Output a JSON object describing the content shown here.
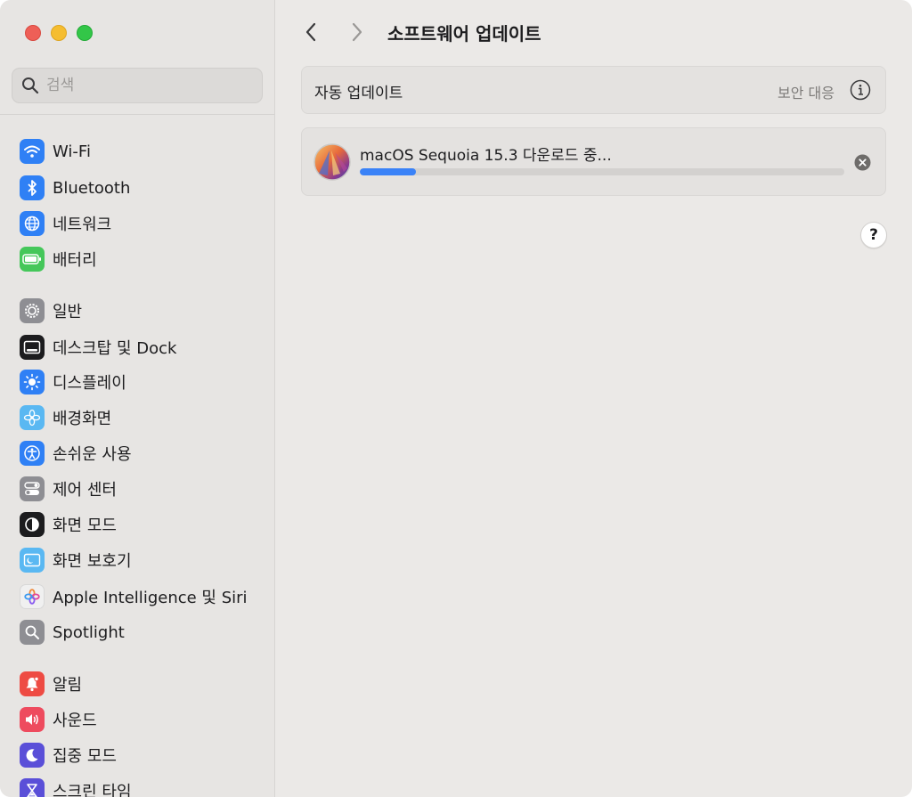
{
  "window": {
    "traffic_lights": [
      "close",
      "minimize",
      "zoom"
    ],
    "colors": {
      "close": "#ee5f57",
      "minimize": "#f5bd30",
      "zoom": "#33c648"
    }
  },
  "sidebar": {
    "search_placeholder": "검색",
    "items": [
      {
        "label": "Wi-Fi",
        "icon": "wifi-icon",
        "color": "#2f80f5"
      },
      {
        "label": "Bluetooth",
        "icon": "bluetooth-icon",
        "color": "#2f80f5"
      },
      {
        "label": "네트워크",
        "icon": "globe-icon",
        "color": "#2f80f5"
      },
      {
        "label": "배터리",
        "icon": "battery-icon",
        "color": "#45c75a"
      },
      {
        "label": "일반",
        "icon": "gear-icon",
        "color": "#8e8e93"
      },
      {
        "label": "데스크탑 및 Dock",
        "icon": "dock-icon",
        "color": "#1c1c1e"
      },
      {
        "label": "디스플레이",
        "icon": "brightness-icon",
        "color": "#2f80f5"
      },
      {
        "label": "배경화면",
        "icon": "flower-icon",
        "color": "#5ab8f2"
      },
      {
        "label": "손쉬운 사용",
        "icon": "accessibility-icon",
        "color": "#2f80f5"
      },
      {
        "label": "제어 센터",
        "icon": "toggles-icon",
        "color": "#8e8e93"
      },
      {
        "label": "화면 모드",
        "icon": "appearance-icon",
        "color": "#1c1c1e"
      },
      {
        "label": "화면 보호기",
        "icon": "screensaver-icon",
        "color": "#5ab8f2"
      },
      {
        "label": "Apple Intelligence 및 Siri",
        "icon": "apple-intelligence-icon",
        "color": "#f0f0f0"
      },
      {
        "label": "Spotlight",
        "icon": "magnifier-icon",
        "color": "#8e8e93"
      },
      {
        "label": "알림",
        "icon": "bell-icon",
        "color": "#ee4b43"
      },
      {
        "label": "사운드",
        "icon": "speaker-icon",
        "color": "#ee4b5e"
      },
      {
        "label": "집중 모드",
        "icon": "moon-icon",
        "color": "#5a4fd8"
      },
      {
        "label": "스크린 타임",
        "icon": "hourglass-icon",
        "color": "#5a4fd8"
      }
    ]
  },
  "main": {
    "title": "소프트웨어 업데이트",
    "auto_update": {
      "label": "자동 업데이트",
      "value": "보안 대응"
    },
    "download": {
      "title": "macOS Sequoia 15.3 다운로드 중...",
      "progress": 0.115
    },
    "help_label": "?"
  },
  "accent_color": "#3a82f7"
}
